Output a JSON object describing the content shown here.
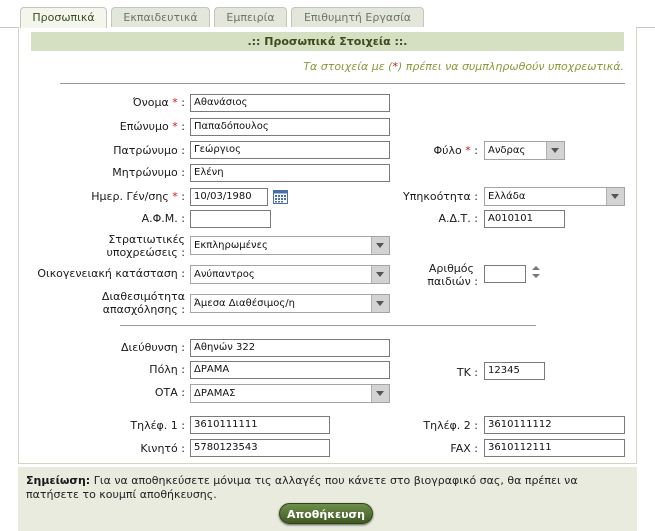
{
  "tabs": [
    {
      "label": "Προσωπικά",
      "active": true
    },
    {
      "label": "Εκπαιδευτικά",
      "active": false
    },
    {
      "label": "Εμπειρία",
      "active": false
    },
    {
      "label": "Επιθυμητή Εργασία",
      "active": false
    }
  ],
  "section_title": ".:: Προσωπικά Στοιχεία ::.",
  "required_note": {
    "before": "Τα στοιχεία με (",
    "star": "*",
    "after": ") πρέπει να συμπληρωθούν υποχρεωτικά."
  },
  "fields": {
    "first_name": {
      "label": "Όνομα",
      "value": "Αθανάσιος",
      "required": true
    },
    "last_name": {
      "label": "Επώνυμο",
      "value": "Παπαδόπουλος",
      "required": true
    },
    "father_name": {
      "label": "Πατρώνυμο",
      "value": "Γεώργιος"
    },
    "mother_name": {
      "label": "Μητρώνυμο",
      "value": "Ελένη"
    },
    "birth_date": {
      "label": "Ημερ. Γέν/σης",
      "value": "10/03/1980",
      "required": true
    },
    "afm": {
      "label": "Α.Φ.Μ.",
      "value": ""
    },
    "military": {
      "label_line1": "Στρατιωτικές",
      "label_line2": "υποχρεώσεις",
      "value": "Εκπληρωμένες"
    },
    "marital": {
      "label": "Οικογενειακή κατάσταση",
      "value": "Ανύπαντρος"
    },
    "availability": {
      "label_line1": "Διαθεσιμότητα",
      "label_line2": "απασχόλησης",
      "value": "Άμεσα Διαθέσιμος/η"
    },
    "gender": {
      "label": "Φύλο",
      "value": "Ανδρας",
      "required": true
    },
    "citizenship": {
      "label": "Υπηκοότητα",
      "value": "Ελλάδα"
    },
    "adt": {
      "label": "Α.Δ.Τ.",
      "value": "Α010101"
    },
    "children": {
      "label_line1": "Αριθμός",
      "label_line2": "παιδιών",
      "value": ""
    },
    "address": {
      "label": "Διεύθυνση",
      "value": "Αθηνών 322"
    },
    "city": {
      "label": "Πόλη",
      "value": "ΔΡΑΜΑ"
    },
    "ota": {
      "label": "ΟΤΑ",
      "value": "ΔΡΑΜΑΣ"
    },
    "tk": {
      "label": "ΤΚ",
      "value": "12345"
    },
    "phone1": {
      "label": "Τηλέφ. 1",
      "value": "3610111111"
    },
    "phone2": {
      "label": "Τηλέφ. 2",
      "value": "3610111112"
    },
    "mobile": {
      "label": "Κινητό",
      "value": "5780123543"
    },
    "fax": {
      "label": "FAX",
      "value": "3610112111"
    }
  },
  "colon": ":",
  "star": "*",
  "note": {
    "bold": "Σημείωση:",
    "text": " Για να αποθηκεύσετε μόνιμα τις αλλαγές που κάνετε στο βιογραφικό σας, θα πρέπει να πατήσετε το κουμπί αποθήκευσης."
  },
  "save_label": "Αποθήκευση",
  "icons": {
    "calendar": "calendar-icon",
    "spinner": "spinner-icon",
    "dropdown": "chevron-down-icon"
  }
}
